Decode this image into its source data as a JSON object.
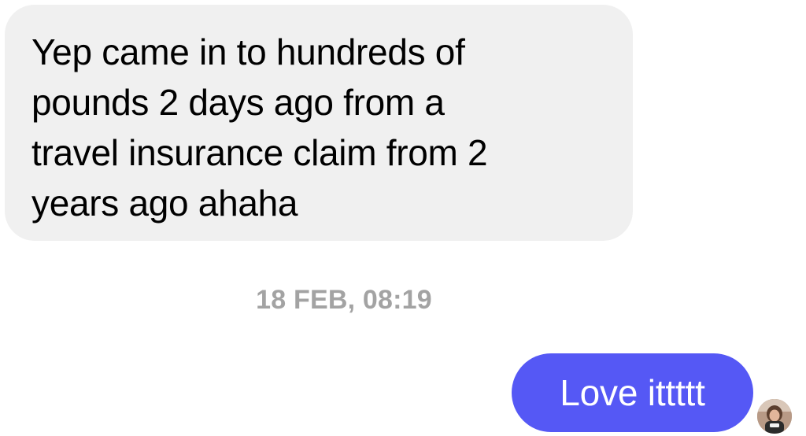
{
  "conversation": {
    "incoming_message": {
      "lines": [
        "Yep came in to hundreds of",
        "pounds 2 days ago from a",
        "travel insurance claim from 2",
        "years ago ahaha"
      ]
    },
    "timestamp": "18 FEB, 08:19",
    "outgoing_message": {
      "text": "Love ittttt"
    },
    "avatar_icon": "user-avatar-photo",
    "colors": {
      "incoming_bubble": "#f0f0f0",
      "outgoing_bubble": "#5558f5",
      "timestamp_text": "#a3a3a3"
    }
  }
}
